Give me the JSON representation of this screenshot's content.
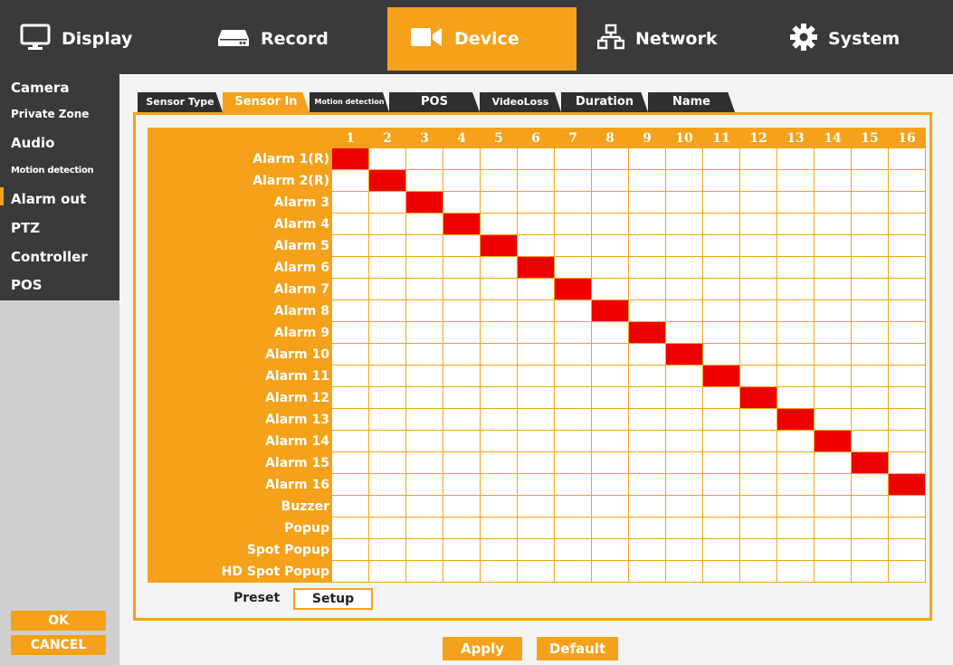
{
  "nav": {
    "tabs": [
      {
        "label": "Display",
        "icon": "monitor-icon"
      },
      {
        "label": "Record",
        "icon": "hdd-icon"
      },
      {
        "label": "Device",
        "icon": "camera-icon"
      },
      {
        "label": "Network",
        "icon": "network-icon"
      },
      {
        "label": "System",
        "icon": "gear-icon"
      }
    ],
    "active": "Device"
  },
  "sidebar": {
    "items": [
      {
        "label": "Camera"
      },
      {
        "label": "Private Zone"
      },
      {
        "label": "Audio"
      },
      {
        "label": "Motion detection"
      },
      {
        "label": "Alarm out"
      },
      {
        "label": "PTZ"
      },
      {
        "label": "Controller"
      },
      {
        "label": "POS"
      }
    ],
    "selected": "Alarm out",
    "ok_label": "OK",
    "cancel_label": "CANCEL"
  },
  "subtabs": {
    "items": [
      {
        "label": "Sensor Type"
      },
      {
        "label": "Sensor In"
      },
      {
        "label": "Motion detection"
      },
      {
        "label": "POS"
      },
      {
        "label": "VideoLoss"
      },
      {
        "label": "Duration"
      },
      {
        "label": "Name"
      }
    ],
    "active": "Sensor In"
  },
  "matrix": {
    "columns": [
      "1",
      "2",
      "3",
      "4",
      "5",
      "6",
      "7",
      "8",
      "9",
      "10",
      "11",
      "12",
      "13",
      "14",
      "15",
      "16"
    ],
    "rows": [
      {
        "label": "Alarm 1(R)",
        "on": [
          1
        ]
      },
      {
        "label": "Alarm 2(R)",
        "on": [
          2
        ]
      },
      {
        "label": "Alarm 3",
        "on": [
          3
        ]
      },
      {
        "label": "Alarm 4",
        "on": [
          4
        ]
      },
      {
        "label": "Alarm 5",
        "on": [
          5
        ]
      },
      {
        "label": "Alarm 6",
        "on": [
          6
        ]
      },
      {
        "label": "Alarm 7",
        "on": [
          7
        ]
      },
      {
        "label": "Alarm 8",
        "on": [
          8
        ]
      },
      {
        "label": "Alarm 9",
        "on": [
          9
        ]
      },
      {
        "label": "Alarm 10",
        "on": [
          10
        ]
      },
      {
        "label": "Alarm 11",
        "on": [
          11
        ]
      },
      {
        "label": "Alarm 12",
        "on": [
          12
        ]
      },
      {
        "label": "Alarm 13",
        "on": [
          13
        ]
      },
      {
        "label": "Alarm 14",
        "on": [
          14
        ]
      },
      {
        "label": "Alarm 15",
        "on": [
          15
        ]
      },
      {
        "label": "Alarm 16",
        "on": [
          16
        ]
      },
      {
        "label": "Buzzer",
        "on": []
      },
      {
        "label": "Popup",
        "on": []
      },
      {
        "label": "Spot Popup",
        "on": []
      },
      {
        "label": "HD Spot Popup",
        "on": []
      }
    ],
    "on_color": "#ee0000",
    "accent_color": "#f5a21a"
  },
  "preset": {
    "label": "Preset",
    "setup_label": "Setup"
  },
  "footer": {
    "apply_label": "Apply",
    "default_label": "Default"
  }
}
